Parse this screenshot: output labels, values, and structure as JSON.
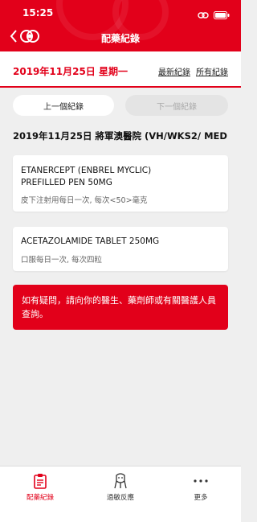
{
  "status_bar": {
    "time": "15:25"
  },
  "header": {
    "title": "配藥紀錄"
  },
  "date_bar": {
    "date": "2019年11月25日 星期一",
    "latest_link": "最新紀錄",
    "all_link": "所有紀錄"
  },
  "pager": {
    "prev_label": "上一個紀錄",
    "next_label": "下一個紀錄"
  },
  "hospital_line": "2019年11月25日 將軍澳醫院 (VH/WKS2/ MED",
  "medications": [
    {
      "name_line1": "ETANERCEPT (ENBREL MYCLIC)",
      "name_line2": "PREFILLED PEN 50MG",
      "dosage": "皮下注射用每日一次, 每次<50>毫克"
    },
    {
      "name_line1": "ACETAZOLAMIDE TABLET 250MG",
      "dosage": "口服每日一次, 每次四粒"
    }
  ],
  "notice": "如有疑問，請向你的醫生、藥劑師或有關醫護人員查詢。",
  "tab_bar": [
    {
      "label": "配藥紀錄",
      "icon": "prescription-icon",
      "active": true
    },
    {
      "label": "過敏反應",
      "icon": "allergy-icon",
      "active": false
    },
    {
      "label": "更多",
      "icon": "more-dots-icon",
      "active": false
    }
  ],
  "colors": {
    "accent": "#e2001a",
    "background": "#efefef",
    "inactive_tab": "#333333",
    "disabled_button": "#e4e4e4"
  }
}
